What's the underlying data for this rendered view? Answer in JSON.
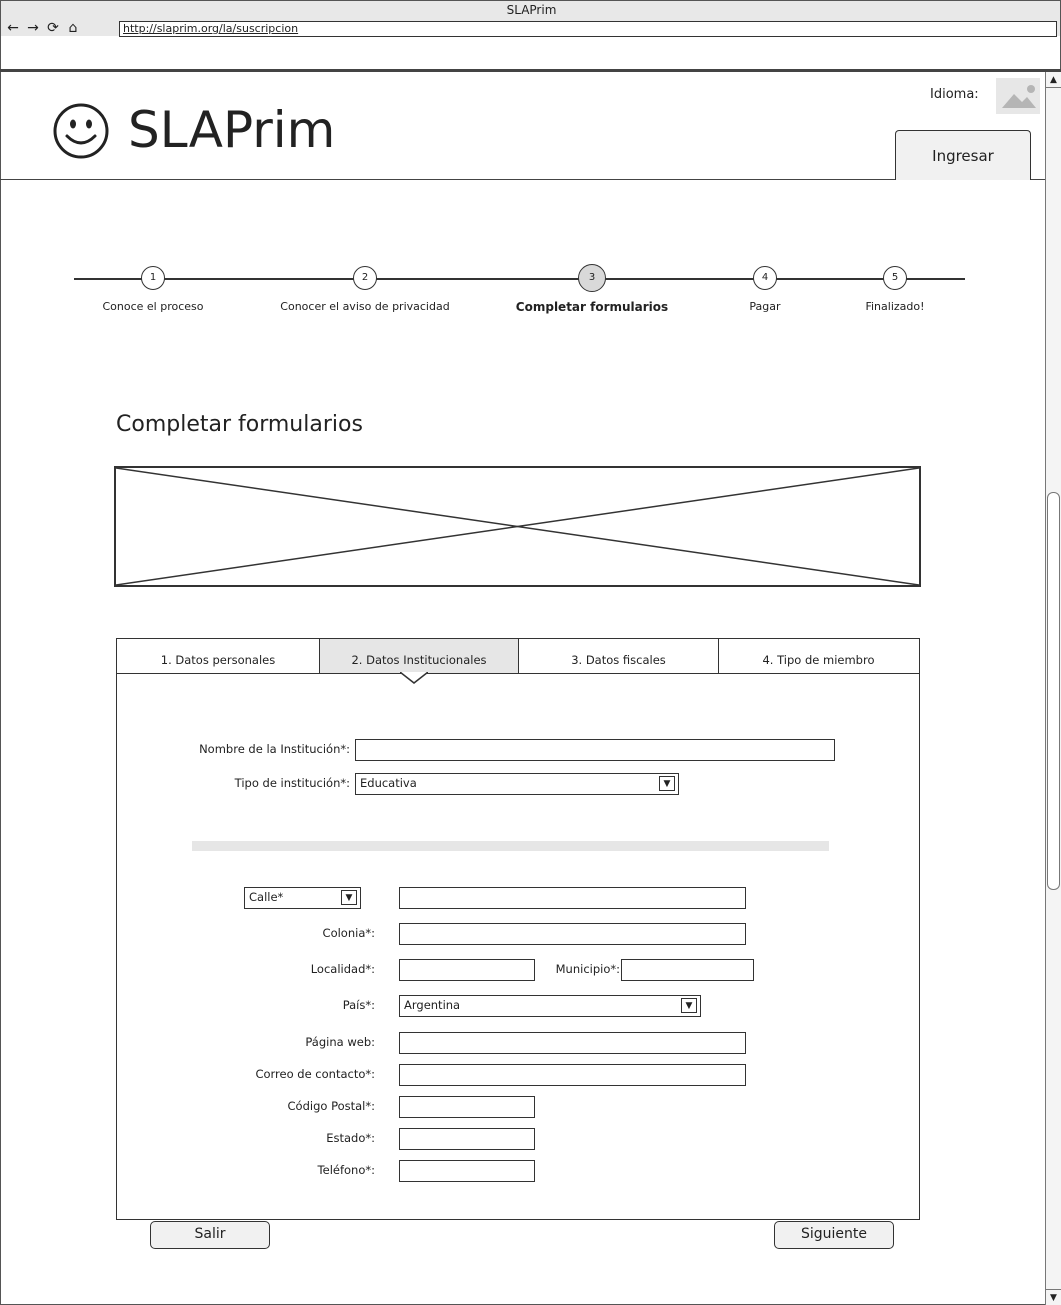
{
  "window": {
    "title": "SLAPrim"
  },
  "browser": {
    "url": "http://slaprim.org/la/suscripcion",
    "nav_icons": [
      "back-icon",
      "forward-icon",
      "reload-icon",
      "home-icon"
    ]
  },
  "header": {
    "brand": "SLAPrim",
    "language_label": "Idioma:",
    "login_label": "Ingresar"
  },
  "stepper": {
    "steps": [
      {
        "number": "1",
        "label": "Conoce el proceso"
      },
      {
        "number": "2",
        "label": "Conocer el aviso de privacidad"
      },
      {
        "number": "3",
        "label": "Completar formularios",
        "current": true
      },
      {
        "number": "4",
        "label": "Pagar"
      },
      {
        "number": "5",
        "label": "Finalizado!"
      }
    ]
  },
  "main": {
    "title": "Completar formularios"
  },
  "tabs": [
    {
      "label": "1. Datos personales"
    },
    {
      "label": "2. Datos Institucionales",
      "active": true
    },
    {
      "label": "3. Datos fiscales"
    },
    {
      "label": "4. Tipo de miembro"
    }
  ],
  "form": {
    "institution_name": {
      "label": "Nombre de la Institución*:",
      "value": ""
    },
    "institution_type": {
      "label": "Tipo de institución*:",
      "value": "Educativa"
    },
    "street_type": {
      "value": "Calle*"
    },
    "street": {
      "value": ""
    },
    "colonia": {
      "label": "Colonia*:",
      "value": ""
    },
    "localidad": {
      "label": "Localidad*:",
      "value": ""
    },
    "municipio": {
      "label": "Municipio*:",
      "value": ""
    },
    "pais": {
      "label": "País*:",
      "value": "Argentina"
    },
    "pagina_web": {
      "label": "Página web:",
      "value": ""
    },
    "correo": {
      "label": "Correo de contacto*:",
      "value": ""
    },
    "codigo_postal": {
      "label": "Código Postal*:",
      "value": ""
    },
    "estado": {
      "label": "Estado*:",
      "value": ""
    },
    "telefono": {
      "label": "Teléfono*:",
      "value": ""
    }
  },
  "buttons": {
    "exit": "Salir",
    "next": "Siguiente"
  },
  "icons": {
    "dropdown": "▼",
    "scroll_up": "▲",
    "scroll_down": "▼"
  }
}
